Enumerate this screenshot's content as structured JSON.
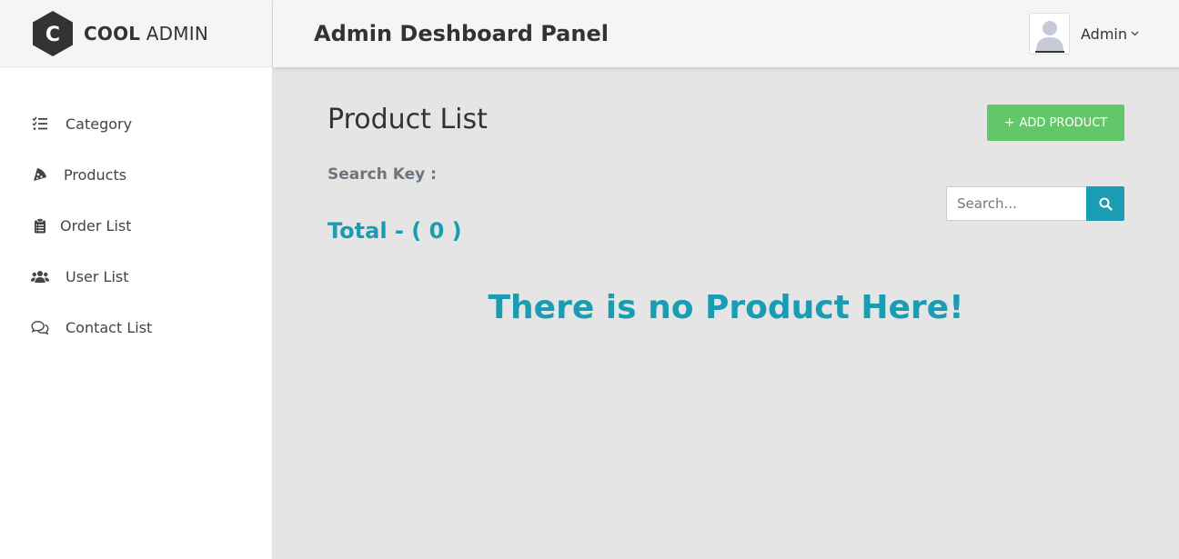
{
  "brand": {
    "bold": "COOL",
    "rest": "ADMIN",
    "letter": "C"
  },
  "header": {
    "title": "Admin Deshboard Panel",
    "user_name": "Admin"
  },
  "sidebar": {
    "items": [
      {
        "label": "Category",
        "icon": "list-check-icon"
      },
      {
        "label": "Products",
        "icon": "pizza-icon"
      },
      {
        "label": "Order List",
        "icon": "clipboard-icon"
      },
      {
        "label": "User List",
        "icon": "users-icon"
      },
      {
        "label": "Contact List",
        "icon": "comments-icon"
      }
    ]
  },
  "main": {
    "page_title": "Product List",
    "add_button_label": "ADD PRODUCT",
    "search_key_label": "Search Key :",
    "search_placeholder": "Search...",
    "total_label": "Total - ( 0 )",
    "empty_message": "There is no Product Here!"
  },
  "colors": {
    "accent": "#1a9cb3",
    "add_button": "#63c76a",
    "sidebar_bg": "#ffffff",
    "content_bg": "#e5e5e5",
    "logo_hex": "#333333"
  }
}
